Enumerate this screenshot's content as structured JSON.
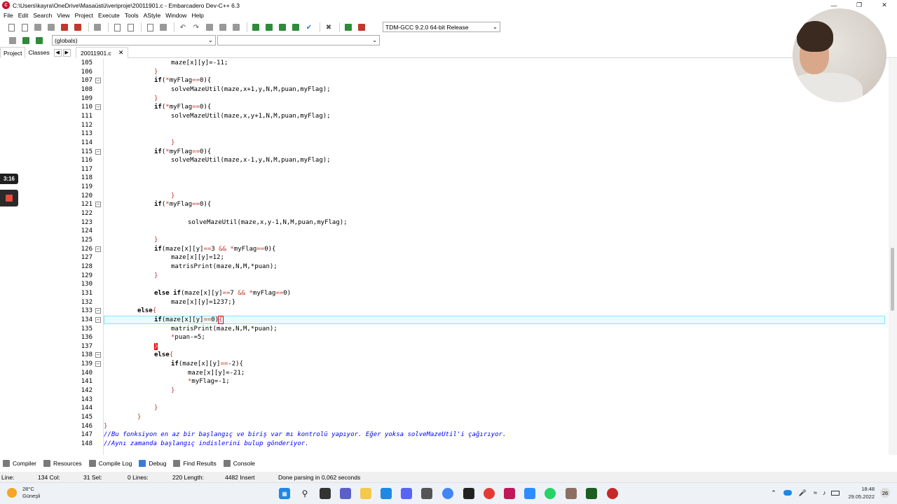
{
  "window": {
    "title": "C:\\Users\\kayra\\OneDrive\\Masaüstü\\veriproje\\20011901.c - Embarcadero Dev-C++ 6.3"
  },
  "menu": [
    "File",
    "Edit",
    "Search",
    "View",
    "Project",
    "Execute",
    "Tools",
    "AStyle",
    "Window",
    "Help"
  ],
  "toolbar": {
    "compiler": "TDM-GCC 9.2.0 64-bit Release",
    "scope": "(globals)"
  },
  "left_tabs": [
    "Project",
    "Classes"
  ],
  "file_tab": "20011901.c",
  "code": [
    {
      "n": "105",
      "fold": "",
      "indent": 4,
      "segs": [
        [
          "t",
          "maze[x][y]=-11;"
        ]
      ]
    },
    {
      "n": "106",
      "fold": "",
      "indent": 3,
      "segs": [
        [
          "o",
          "}"
        ]
      ]
    },
    {
      "n": "107",
      "fold": "-",
      "indent": 3,
      "segs": [
        [
          "k",
          "if"
        ],
        [
          "t",
          "("
        ],
        [
          "o",
          "*"
        ],
        [
          "t",
          "myFlag"
        ],
        [
          "o",
          "=="
        ],
        [
          "t",
          "0){"
        ]
      ]
    },
    {
      "n": "108",
      "fold": "",
      "indent": 4,
      "segs": [
        [
          "t",
          "solveMazeUtil(maze,x+1,y,N,M,puan,myFlag);"
        ]
      ]
    },
    {
      "n": "109",
      "fold": "",
      "indent": 3,
      "segs": [
        [
          "o",
          "}"
        ]
      ]
    },
    {
      "n": "110",
      "fold": "-",
      "indent": 3,
      "segs": [
        [
          "k",
          "if"
        ],
        [
          "t",
          "("
        ],
        [
          "o",
          "*"
        ],
        [
          "t",
          "myFlag"
        ],
        [
          "o",
          "=="
        ],
        [
          "t",
          "0){"
        ]
      ]
    },
    {
      "n": "111",
      "fold": "",
      "indent": 4,
      "segs": [
        [
          "t",
          "solveMazeUtil(maze,x,y+1,N,M,puan,myFlag);"
        ]
      ]
    },
    {
      "n": "112",
      "fold": "",
      "indent": 0,
      "segs": []
    },
    {
      "n": "113",
      "fold": "",
      "indent": 0,
      "segs": []
    },
    {
      "n": "114",
      "fold": "",
      "indent": 4,
      "segs": [
        [
          "o",
          "}"
        ]
      ]
    },
    {
      "n": "115",
      "fold": "-",
      "indent": 3,
      "segs": [
        [
          "k",
          "if"
        ],
        [
          "t",
          "("
        ],
        [
          "o",
          "*"
        ],
        [
          "t",
          "myFlag"
        ],
        [
          "o",
          "=="
        ],
        [
          "t",
          "0){"
        ]
      ]
    },
    {
      "n": "116",
      "fold": "",
      "indent": 4,
      "segs": [
        [
          "t",
          "solveMazeUtil(maze,x-1,y,N,M,puan,myFlag);"
        ]
      ]
    },
    {
      "n": "117",
      "fold": "",
      "indent": 0,
      "segs": []
    },
    {
      "n": "118",
      "fold": "",
      "indent": 0,
      "segs": []
    },
    {
      "n": "119",
      "fold": "",
      "indent": 0,
      "segs": []
    },
    {
      "n": "120",
      "fold": "",
      "indent": 4,
      "segs": [
        [
          "o",
          "}"
        ]
      ]
    },
    {
      "n": "121",
      "fold": "-",
      "indent": 3,
      "segs": [
        [
          "k",
          "if"
        ],
        [
          "t",
          "("
        ],
        [
          "o",
          "*"
        ],
        [
          "t",
          "myFlag"
        ],
        [
          "o",
          "=="
        ],
        [
          "t",
          "0){"
        ]
      ]
    },
    {
      "n": "122",
      "fold": "",
      "indent": 0,
      "segs": []
    },
    {
      "n": "123",
      "fold": "",
      "indent": 5,
      "segs": [
        [
          "t",
          "solveMazeUtil(maze,x,y-1,N,M,puan,myFlag);"
        ]
      ]
    },
    {
      "n": "124",
      "fold": "",
      "indent": 0,
      "segs": []
    },
    {
      "n": "125",
      "fold": "",
      "indent": 3,
      "segs": [
        [
          "o",
          "}"
        ]
      ]
    },
    {
      "n": "126",
      "fold": "-",
      "indent": 3,
      "segs": [
        [
          "k",
          "if"
        ],
        [
          "t",
          "(maze[x][y]"
        ],
        [
          "o",
          "=="
        ],
        [
          "t",
          "3 "
        ],
        [
          "o",
          "&&"
        ],
        [
          "t",
          " "
        ],
        [
          "o",
          "*"
        ],
        [
          "t",
          "myFlag"
        ],
        [
          "o",
          "=="
        ],
        [
          "t",
          "0){"
        ]
      ]
    },
    {
      "n": "127",
      "fold": "",
      "indent": 4,
      "segs": [
        [
          "t",
          "maze[x][y]=12;"
        ]
      ]
    },
    {
      "n": "128",
      "fold": "",
      "indent": 4,
      "segs": [
        [
          "t",
          "matrisPrint(maze,N,M,*puan);"
        ]
      ]
    },
    {
      "n": "129",
      "fold": "",
      "indent": 3,
      "segs": [
        [
          "o",
          "}"
        ]
      ]
    },
    {
      "n": "130",
      "fold": "",
      "indent": 0,
      "segs": []
    },
    {
      "n": "131",
      "fold": "",
      "indent": 3,
      "segs": [
        [
          "k",
          "else if"
        ],
        [
          "t",
          "(maze[x][y]"
        ],
        [
          "o",
          "=="
        ],
        [
          "t",
          "7 "
        ],
        [
          "o",
          "&&"
        ],
        [
          "t",
          " "
        ],
        [
          "o",
          "*"
        ],
        [
          "t",
          "myFlag"
        ],
        [
          "o",
          "=="
        ],
        [
          "t",
          "0)"
        ]
      ]
    },
    {
      "n": "132",
      "fold": "",
      "indent": 4,
      "segs": [
        [
          "t",
          "maze[x][y]=1237;}"
        ]
      ]
    },
    {
      "n": "133",
      "fold": "-",
      "indent": 2,
      "segs": [
        [
          "k",
          "else"
        ],
        [
          "o",
          "{"
        ]
      ]
    },
    {
      "n": "134",
      "fold": "-",
      "indent": 3,
      "hl": true,
      "segs": [
        [
          "k",
          "if"
        ],
        [
          "t",
          "(maze[x][y]"
        ],
        [
          "o",
          "=="
        ],
        [
          "t",
          "0)"
        ],
        [
          "b",
          "{"
        ]
      ]
    },
    {
      "n": "135",
      "fold": "",
      "indent": 4,
      "segs": [
        [
          "t",
          "matrisPrint(maze,N,M,*puan);"
        ]
      ]
    },
    {
      "n": "136",
      "fold": "",
      "indent": 4,
      "segs": [
        [
          "o",
          "*"
        ],
        [
          "t",
          "puan-=5;"
        ]
      ]
    },
    {
      "n": "137",
      "fold": "",
      "indent": 3,
      "segs": [
        [
          "m",
          "}"
        ]
      ]
    },
    {
      "n": "138",
      "fold": "-",
      "indent": 3,
      "segs": [
        [
          "k",
          "else"
        ],
        [
          "o",
          "{"
        ]
      ]
    },
    {
      "n": "139",
      "fold": "-",
      "indent": 4,
      "segs": [
        [
          "k",
          "if"
        ],
        [
          "t",
          "(maze[x][y]"
        ],
        [
          "o",
          "=="
        ],
        [
          "t",
          "-2){"
        ]
      ]
    },
    {
      "n": "140",
      "fold": "",
      "indent": 5,
      "segs": [
        [
          "t",
          "maze[x][y]=-21;"
        ]
      ]
    },
    {
      "n": "141",
      "fold": "",
      "indent": 5,
      "segs": [
        [
          "o",
          "*"
        ],
        [
          "t",
          "myFlag=-1;"
        ]
      ]
    },
    {
      "n": "142",
      "fold": "",
      "indent": 4,
      "segs": [
        [
          "o",
          "}"
        ]
      ]
    },
    {
      "n": "143",
      "fold": "",
      "indent": 0,
      "segs": []
    },
    {
      "n": "144",
      "fold": "",
      "indent": 3,
      "segs": [
        [
          "o",
          "}"
        ]
      ]
    },
    {
      "n": "145",
      "fold": "",
      "indent": 2,
      "segs": [
        [
          "o",
          "}"
        ]
      ]
    },
    {
      "n": "146",
      "fold": "",
      "indent": 0,
      "segs": [
        [
          "o",
          "}"
        ]
      ]
    },
    {
      "n": "147",
      "fold": "",
      "indent": 0,
      "segs": [
        [
          "c",
          "//Bu fonksiyon en az bir başlangıç ve biriş var mı kontrolü yapıyor. Eğer yoksa solveMazeUtil'i çağırıyor."
        ]
      ]
    },
    {
      "n": "148",
      "fold": "",
      "indent": 0,
      "segs": [
        [
          "c",
          "//Aynı zamanda başlangıç indislerini bulup gönderiyor."
        ]
      ]
    }
  ],
  "bottom_tabs": [
    "Compiler",
    "Resources",
    "Compile Log",
    "Debug",
    "Find Results",
    "Console"
  ],
  "status": {
    "line": "Line:",
    "line_val": "134 Col:",
    "col_val": "31 Sel:",
    "sel_val": "0 Lines:",
    "lines_val": "220 Length:",
    "length_val": "4482  Insert",
    "message": "Done parsing in 0,062 seconds"
  },
  "overlay": {
    "timer": "3:16"
  },
  "taskbar": {
    "temp": "28°C",
    "weather": "Güneşli",
    "time": "18:48",
    "date": "29.05.2022",
    "notif": "26"
  }
}
